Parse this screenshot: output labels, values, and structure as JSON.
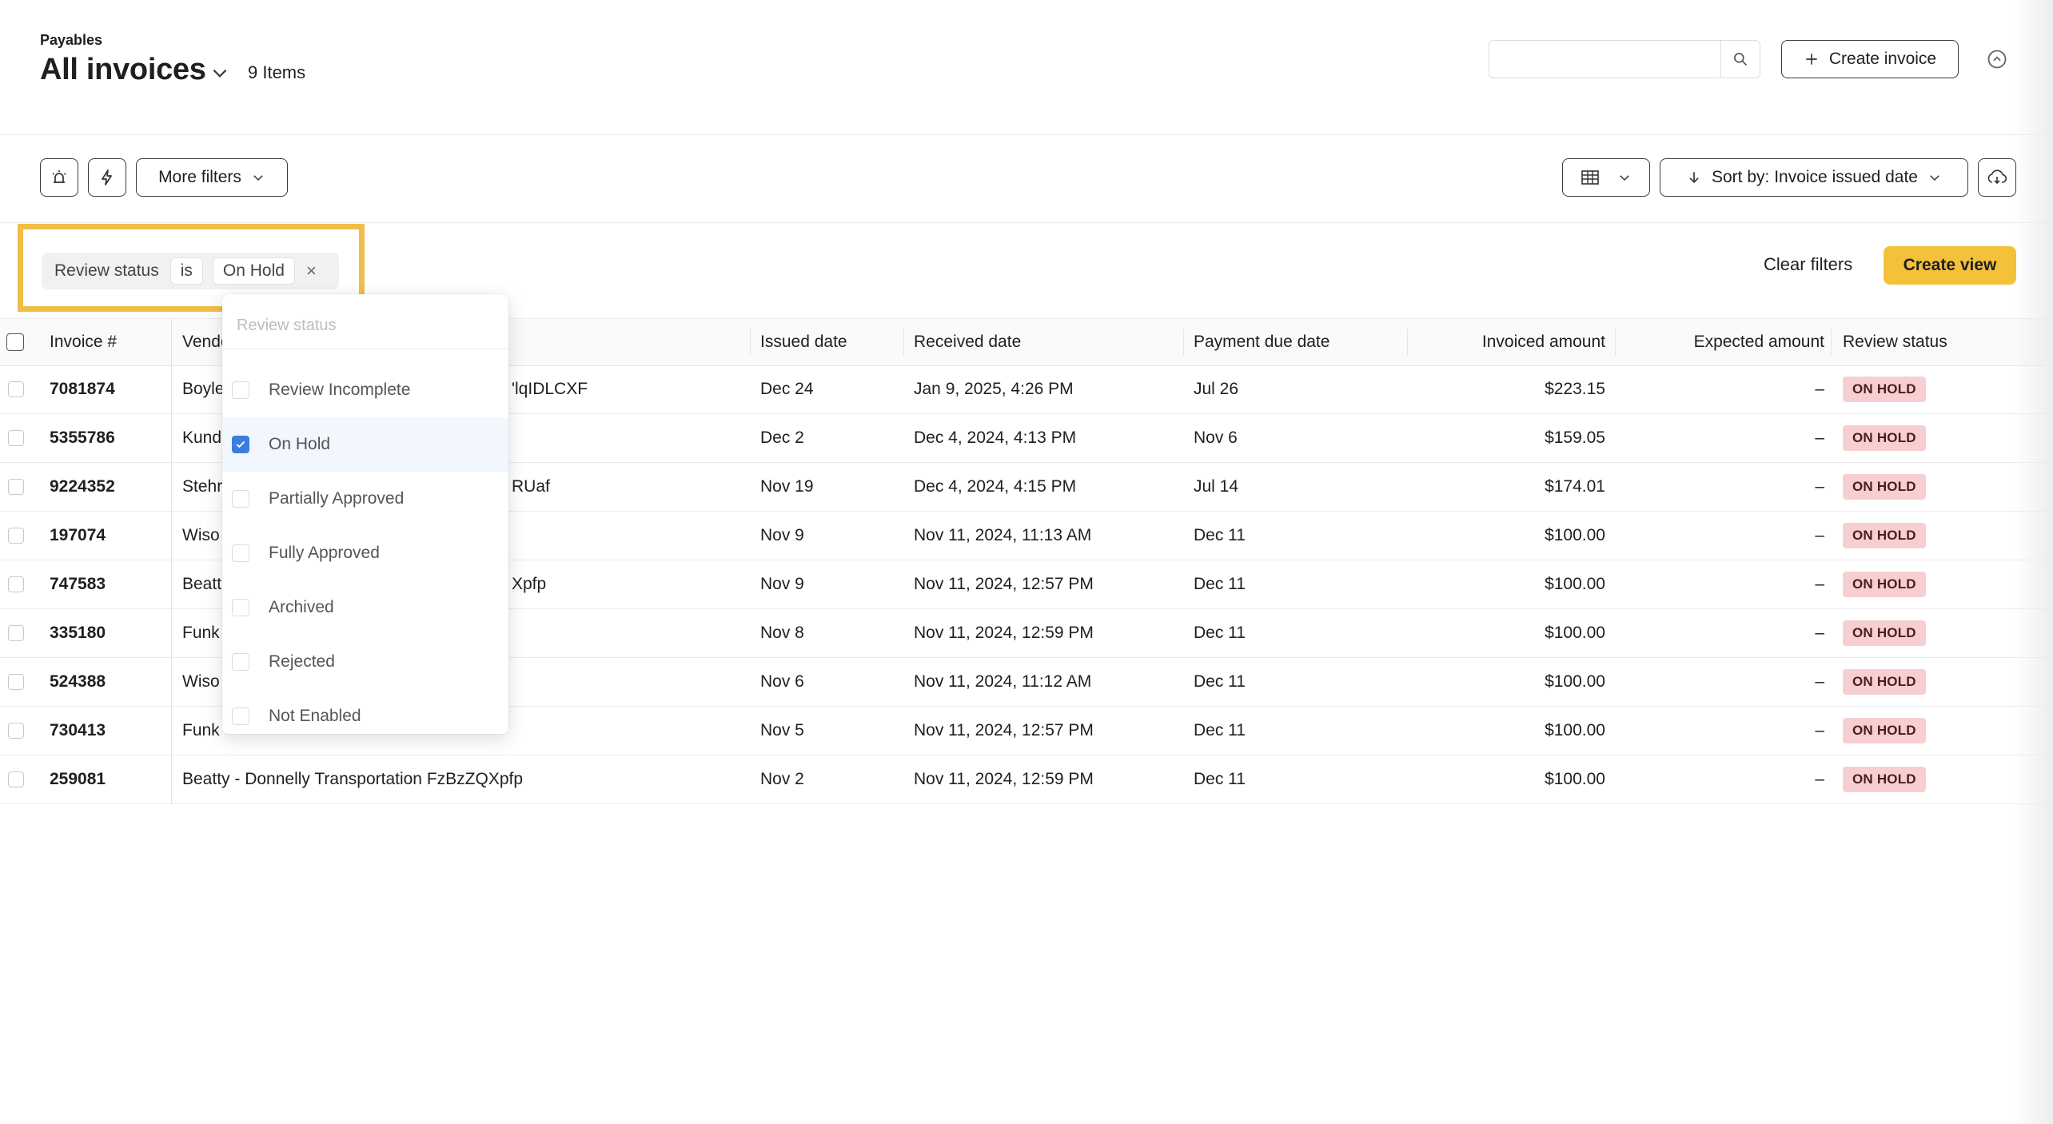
{
  "header": {
    "eyebrow": "Payables",
    "title": "All invoices",
    "items_count": "9 Items",
    "search_placeholder": "",
    "create_invoice_label": "Create invoice"
  },
  "toolbar": {
    "more_filters_label": "More filters",
    "sort_label": "Sort by: Invoice issued date"
  },
  "filter_chip": {
    "field": "Review status",
    "operator": "is",
    "value": "On Hold"
  },
  "actions": {
    "clear_filters": "Clear filters",
    "create_view": "Create view"
  },
  "dropdown": {
    "search_placeholder": "Review status",
    "options": [
      {
        "label": "Review Incomplete",
        "checked": false
      },
      {
        "label": "On Hold",
        "checked": true
      },
      {
        "label": "Partially Approved",
        "checked": false
      },
      {
        "label": "Fully Approved",
        "checked": false
      },
      {
        "label": "Archived",
        "checked": false
      },
      {
        "label": "Rejected",
        "checked": false
      },
      {
        "label": "Not Enabled",
        "checked": false
      }
    ]
  },
  "table": {
    "columns": {
      "invoice": "Invoice #",
      "vendor": "Vendor",
      "issued": "Issued date",
      "received": "Received date",
      "due": "Payment due date",
      "invoiced": "Invoiced amount",
      "expected": "Expected amount",
      "status": "Review status"
    },
    "rows": [
      {
        "invoice": "7081874",
        "vendor": "Boyle",
        "vendor_tail": "'lqIDLCXF",
        "issued": "Dec 24",
        "received": "Jan 9, 2025, 4:26 PM",
        "due": "Jul 26",
        "invoiced": "$223.15",
        "expected": "–",
        "status": "ON HOLD"
      },
      {
        "invoice": "5355786",
        "vendor": "Kund",
        "vendor_tail": "",
        "issued": "Dec 2",
        "received": "Dec 4, 2024, 4:13 PM",
        "due": "Nov 6",
        "invoiced": "$159.05",
        "expected": "–",
        "status": "ON HOLD"
      },
      {
        "invoice": "9224352",
        "vendor": "Stehr",
        "vendor_tail": "RUaf",
        "issued": "Nov 19",
        "received": "Dec 4, 2024, 4:15 PM",
        "due": "Jul 14",
        "invoiced": "$174.01",
        "expected": "–",
        "status": "ON HOLD"
      },
      {
        "invoice": "197074",
        "vendor": "Wiso",
        "vendor_tail": "",
        "issued": "Nov 9",
        "received": "Nov 11, 2024, 11:13 AM",
        "due": "Dec 11",
        "invoiced": "$100.00",
        "expected": "–",
        "status": "ON HOLD"
      },
      {
        "invoice": "747583",
        "vendor": "Beatt",
        "vendor_tail": "Xpfp",
        "issued": "Nov 9",
        "received": "Nov 11, 2024, 12:57 PM",
        "due": "Dec 11",
        "invoiced": "$100.00",
        "expected": "–",
        "status": "ON HOLD"
      },
      {
        "invoice": "335180",
        "vendor": "Funk",
        "vendor_tail": "",
        "issued": "Nov 8",
        "received": "Nov 11, 2024, 12:59 PM",
        "due": "Dec 11",
        "invoiced": "$100.00",
        "expected": "–",
        "status": "ON HOLD"
      },
      {
        "invoice": "524388",
        "vendor": "Wiso",
        "vendor_tail": "",
        "issued": "Nov 6",
        "received": "Nov 11, 2024, 11:12 AM",
        "due": "Dec 11",
        "invoiced": "$100.00",
        "expected": "–",
        "status": "ON HOLD"
      },
      {
        "invoice": "730413",
        "vendor": "Funk",
        "vendor_tail": "",
        "issued": "Nov 5",
        "received": "Nov 11, 2024, 12:57 PM",
        "due": "Dec 11",
        "invoiced": "$100.00",
        "expected": "–",
        "status": "ON HOLD"
      },
      {
        "invoice": "259081",
        "vendor": "Beatty - Donnelly Transportation FzBzZQXpfp",
        "vendor_tail": "",
        "issued": "Nov 2",
        "received": "Nov 11, 2024, 12:59 PM",
        "due": "Dec 11",
        "invoiced": "$100.00",
        "expected": "–",
        "status": "ON HOLD"
      }
    ]
  },
  "colors": {
    "accent_yellow": "#f3c13a",
    "highlight_border": "#f0be48",
    "badge_bg": "#f8cfd0",
    "checkbox_blue": "#3b7ddd"
  }
}
